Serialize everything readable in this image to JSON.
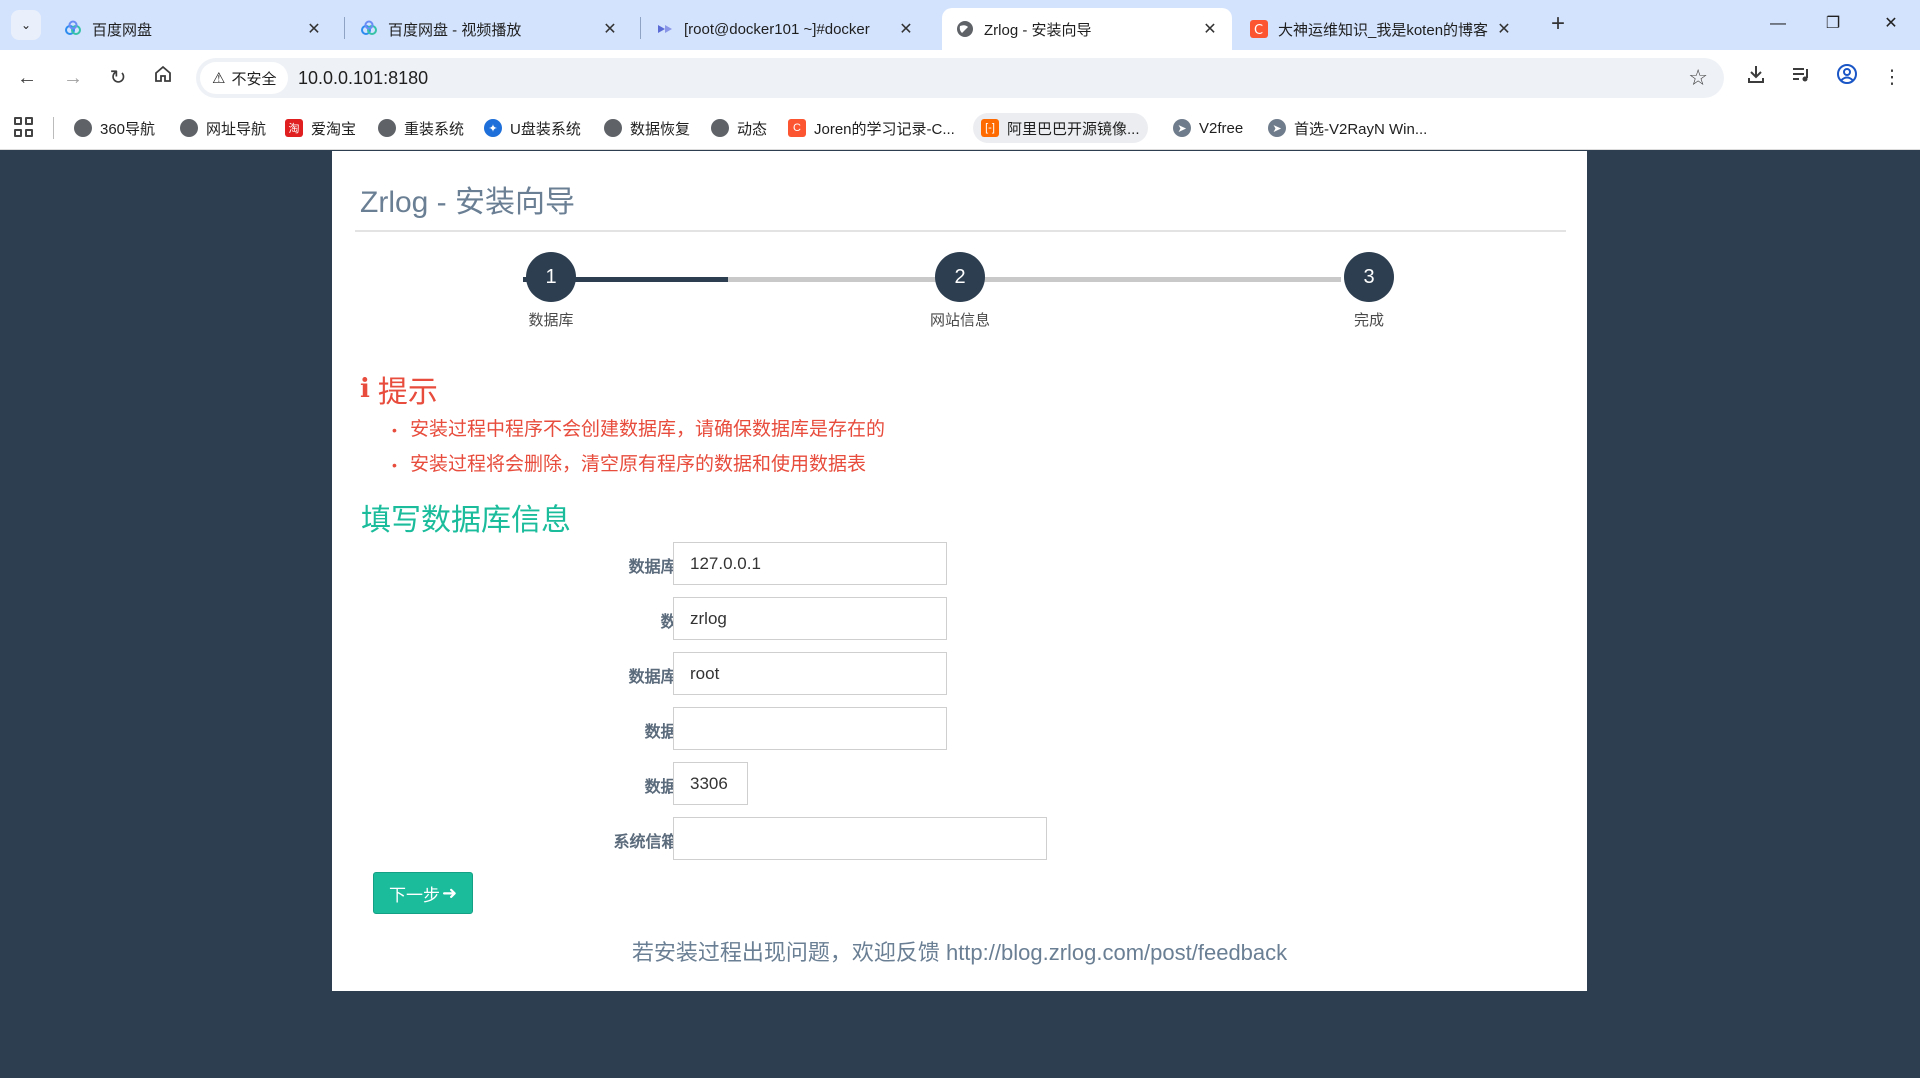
{
  "browser": {
    "tabs": [
      {
        "title": "百度网盘",
        "icon": "baidu-netdisk-icon",
        "active": false
      },
      {
        "title": "百度网盘 - 视频播放",
        "icon": "baidu-netdisk-icon",
        "active": false
      },
      {
        "title": "[root@docker101 ~]#docker",
        "icon": "web-terminal-icon",
        "active": false
      },
      {
        "title": "Zrlog - 安装向导",
        "icon": "globe-icon",
        "active": true
      },
      {
        "title": "大神运维知识_我是koten的博客",
        "icon": "csdn-icon",
        "active": false
      }
    ],
    "security_label": "不安全",
    "url": "10.0.0.101:8180",
    "bookmarks": [
      {
        "label": "360导航",
        "icon": "globe-icon"
      },
      {
        "label": "网址导航",
        "icon": "globe-icon"
      },
      {
        "label": "爱淘宝",
        "icon": "taobao-icon"
      },
      {
        "label": "重装系统",
        "icon": "globe-icon"
      },
      {
        "label": "U盘装系统",
        "icon": "usb-tool-icon"
      },
      {
        "label": "数据恢复",
        "icon": "globe-icon"
      },
      {
        "label": "动态",
        "icon": "globe-icon"
      },
      {
        "label": "Joren的学习记录-C...",
        "icon": "csdn-icon"
      },
      {
        "label": "阿里巴巴开源镜像...",
        "icon": "aliyun-icon"
      },
      {
        "label": "V2free",
        "icon": "telegram-icon"
      },
      {
        "label": "首选-V2RayN Win...",
        "icon": "telegram-icon"
      }
    ]
  },
  "page": {
    "title": "Zrlog - 安装向导",
    "progress_fraction": 0.25,
    "steps": [
      {
        "number": "1",
        "label": "数据库"
      },
      {
        "number": "2",
        "label": "网站信息"
      },
      {
        "number": "3",
        "label": "完成"
      }
    ],
    "tips": {
      "heading": "提示",
      "items": [
        "安装过程中程序不会创建数据库，请确保数据库是存在的",
        "安装过程将会删除，清空原有程序的数据和使用数据表"
      ]
    },
    "form": {
      "heading": "填写数据库信息",
      "fields": [
        {
          "label": "数据库服务器:",
          "value": "127.0.0.1"
        },
        {
          "label": "数据库名:",
          "value": "zrlog"
        },
        {
          "label": "数据库用户名:",
          "value": "root"
        },
        {
          "label": "数据库密码:",
          "value": ""
        },
        {
          "label": "数据库端口:",
          "value": "3306"
        },
        {
          "label": "系统信箱 Email:",
          "value": ""
        }
      ],
      "next_label": "下一步"
    },
    "feedback_text": "若安装过程出现问题，欢迎反馈 http://blog.zrlog.com/post/feedback"
  },
  "colors": {
    "page_bg": "#2c3e50",
    "step_active": "#2c3e50",
    "tip_red": "#e74c3c",
    "accent_green": "#1abc9c"
  }
}
